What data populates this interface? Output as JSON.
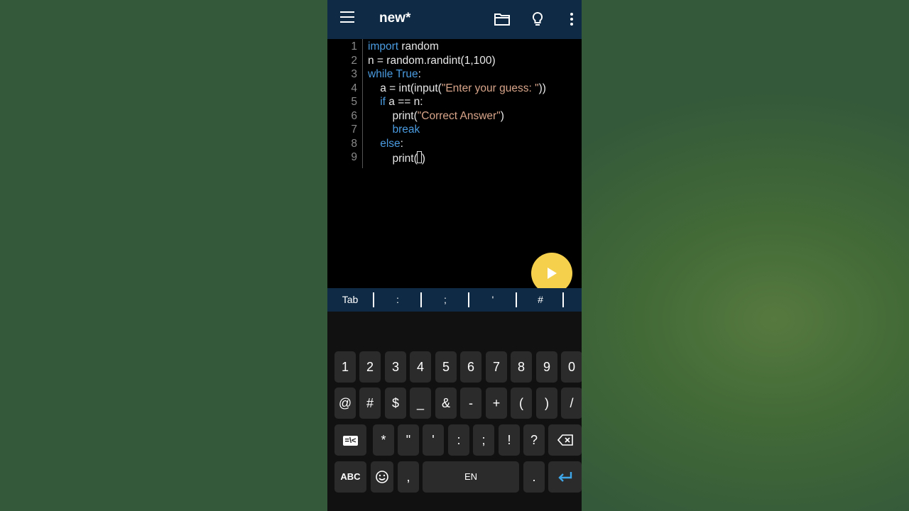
{
  "appbar": {
    "title": "new*",
    "icons": [
      "menu-icon",
      "folder-icon",
      "lightbulb-icon",
      "more-vert-icon"
    ]
  },
  "editor": {
    "line_numbers": [
      "1",
      "2",
      "3",
      "4",
      "5",
      "6",
      "7",
      "8",
      "9"
    ],
    "lines": [
      [
        {
          "t": "import",
          "c": "kw"
        },
        {
          "t": " random",
          "c": ""
        }
      ],
      [
        {
          "t": "n = random.randint(1,100)",
          "c": ""
        }
      ],
      [
        {
          "t": "while True",
          "c": "kw"
        },
        {
          "t": ":",
          "c": ""
        }
      ],
      [
        {
          "t": "    a = int(input(",
          "c": ""
        },
        {
          "t": "\"Enter your guess: \"",
          "c": "str"
        },
        {
          "t": "))",
          "c": ""
        }
      ],
      [
        {
          "t": "    ",
          "c": ""
        },
        {
          "t": "if",
          "c": "kw"
        },
        {
          "t": " a == n:",
          "c": ""
        }
      ],
      [
        {
          "t": "        print(",
          "c": ""
        },
        {
          "t": "\"Correct Answer\"",
          "c": "str"
        },
        {
          "t": ")",
          "c": ""
        }
      ],
      [
        {
          "t": "        ",
          "c": ""
        },
        {
          "t": "break",
          "c": "kw"
        }
      ],
      [
        {
          "t": "    ",
          "c": ""
        },
        {
          "t": "else",
          "c": "kw"
        },
        {
          "t": ":",
          "c": ""
        }
      ],
      [
        {
          "t": "        print(",
          "c": ""
        },
        {
          "t": ")",
          "c": ""
        }
      ]
    ]
  },
  "run_button": {
    "icon": "play-icon"
  },
  "symbol_bar": [
    "Tab",
    ":",
    ";",
    "'",
    "#"
  ],
  "keyboard": {
    "row1": [
      "1",
      "2",
      "3",
      "4",
      "5",
      "6",
      "7",
      "8",
      "9",
      "0"
    ],
    "row2": [
      "@",
      "#",
      "$",
      "_",
      "&",
      "-",
      "+",
      "(",
      ")",
      "/"
    ],
    "row3": [
      "=\\<",
      "*",
      "\"",
      "'",
      ":",
      ";",
      "!",
      "?"
    ],
    "row4": {
      "abc": "ABC",
      "comma": ",",
      "space": "EN",
      "period": "."
    }
  },
  "colors": {
    "appbar": "#0e2a44",
    "keyword": "#4a9be0",
    "string": "#d9a58a",
    "fab": "#f4d04c"
  }
}
